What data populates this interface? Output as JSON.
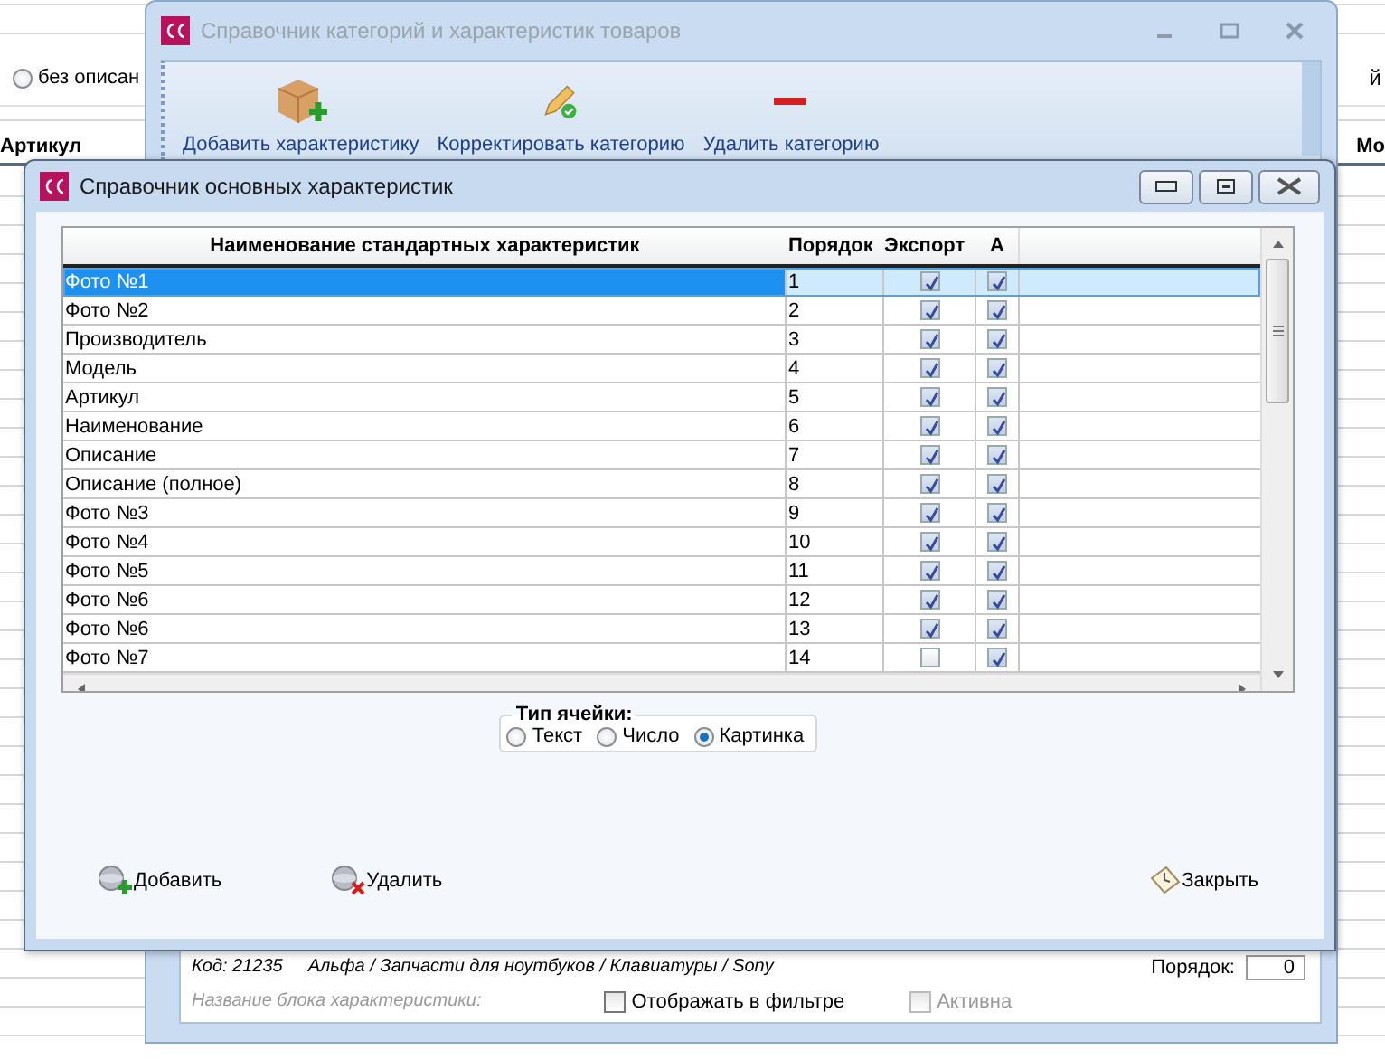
{
  "background_window": {
    "radio": {
      "label": "без описан",
      "selected": false
    },
    "column_headers": [
      "Артикул",
      "Мо"
    ],
    "edge_text": "й"
  },
  "category_window": {
    "title": "Справочник категорий и характеристик товаров",
    "toolbar": [
      {
        "label": "Добавить характеристику",
        "kind": "add"
      },
      {
        "label": "Корректировать категорию",
        "kind": "edit"
      },
      {
        "label": "Удалить категорию",
        "kind": "delete"
      }
    ],
    "info": {
      "code": "Код: 21235",
      "path": "Альфа / Запчасти для ноутбуков / Клавиатуры / Sony",
      "block_label": "Название блока характеристики:",
      "order_label": "Порядок:",
      "order_value": "0"
    },
    "checkboxes": [
      {
        "label": "Отображать в фильтре",
        "checked": false,
        "disabled": false
      },
      {
        "label": "Активна",
        "checked": false,
        "disabled": true
      }
    ]
  },
  "characteristics_window": {
    "title": "Справочник основных характеристик",
    "table": {
      "columns": [
        "Наименование стандартных характеристик",
        "Порядок",
        "Экспорт",
        "А"
      ],
      "rows": [
        {
          "name": "Фото №1",
          "order": "1",
          "export": true,
          "a": true,
          "selected": true
        },
        {
          "name": "Фото №2",
          "order": "2",
          "export": true,
          "a": true,
          "selected": false
        },
        {
          "name": "Производитель",
          "order": "3",
          "export": true,
          "a": true,
          "selected": false
        },
        {
          "name": "Модель",
          "order": "4",
          "export": true,
          "a": true,
          "selected": false
        },
        {
          "name": "Артикул",
          "order": "5",
          "export": true,
          "a": true,
          "selected": false
        },
        {
          "name": "Наименование",
          "order": "6",
          "export": true,
          "a": true,
          "selected": false
        },
        {
          "name": "Описание",
          "order": "7",
          "export": true,
          "a": true,
          "selected": false
        },
        {
          "name": "Описание (полное)",
          "order": "8",
          "export": true,
          "a": true,
          "selected": false
        },
        {
          "name": "Фото №3",
          "order": "9",
          "export": true,
          "a": true,
          "selected": false
        },
        {
          "name": "Фото №4",
          "order": "10",
          "export": true,
          "a": true,
          "selected": false
        },
        {
          "name": "Фото №5",
          "order": "11",
          "export": true,
          "a": true,
          "selected": false
        },
        {
          "name": "Фото №6",
          "order": "12",
          "export": true,
          "a": true,
          "selected": false
        },
        {
          "name": "Фото №6",
          "order": "13",
          "export": true,
          "a": true,
          "selected": false
        },
        {
          "name": "Фото №7",
          "order": "14",
          "export": false,
          "a": true,
          "selected": false
        }
      ]
    },
    "cell_type": {
      "label": "Тип ячейки:",
      "options": [
        {
          "label": "Текст",
          "selected": false
        },
        {
          "label": "Число",
          "selected": false
        },
        {
          "label": "Картинка",
          "selected": true
        }
      ]
    },
    "buttons": [
      {
        "label": "Добавить",
        "kind": "add"
      },
      {
        "label": "Удалить",
        "kind": "delete"
      },
      {
        "label": "Закрыть",
        "kind": "close"
      }
    ]
  }
}
